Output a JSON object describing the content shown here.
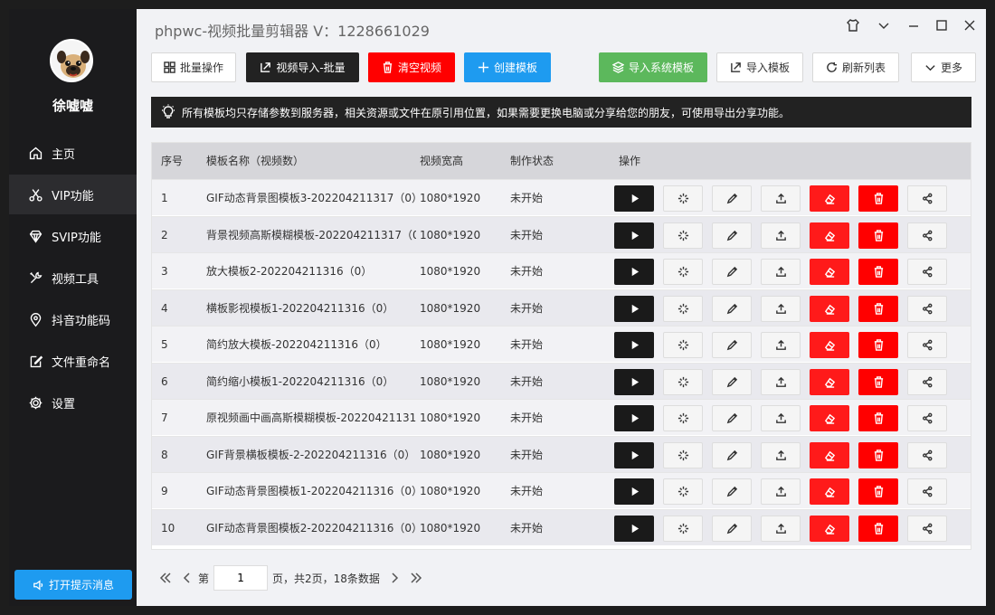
{
  "app": {
    "title": "phpwc-视频批量剪辑器 V：1228661029"
  },
  "sidebar": {
    "username": "徐嘘嘘",
    "items": [
      {
        "label": "主页",
        "icon": "home-icon"
      },
      {
        "label": "VIP功能",
        "icon": "scissors-icon"
      },
      {
        "label": "SVIP功能",
        "icon": "diamond-icon"
      },
      {
        "label": "视频工具",
        "icon": "tools-icon"
      },
      {
        "label": "抖音功能码",
        "icon": "location-icon"
      },
      {
        "label": "文件重命名",
        "icon": "edit-file-icon"
      },
      {
        "label": "设置",
        "icon": "gear-icon"
      }
    ],
    "notify_label": "打开提示消息"
  },
  "toolbar": {
    "batch_ops": "批量操作",
    "import_video_batch": "视频导入-批量",
    "clear_video": "清空视频",
    "create_template": "创建模板",
    "import_system_template": "导入系统模板",
    "import_template": "导入模板",
    "refresh_list": "刷新列表",
    "more": "更多"
  },
  "notice": {
    "text": "所有模板均只存储参数到服务器，相关资源或文件在原引用位置，如果需要更换电脑或分享给您的朋友，可使用导出分享功能。"
  },
  "table": {
    "headers": [
      "序号",
      "模板名称（视频数）",
      "视频宽高",
      "制作状态",
      "操作"
    ],
    "rows": [
      {
        "index": "1",
        "name": "GIF动态背景图模板3-202204211317（0）",
        "size": "1080*1920",
        "status": "未开始"
      },
      {
        "index": "2",
        "name": "背景视频高斯模糊模板-202204211317（0",
        "size": "1080*1920",
        "status": "未开始"
      },
      {
        "index": "3",
        "name": "放大模板2-202204211316（0）",
        "size": "1080*1920",
        "status": "未开始"
      },
      {
        "index": "4",
        "name": "横板影视模板1-202204211316（0）",
        "size": "1080*1920",
        "status": "未开始"
      },
      {
        "index": "5",
        "name": "简约放大模板-202204211316（0）",
        "size": "1080*1920",
        "status": "未开始"
      },
      {
        "index": "6",
        "name": "简约缩小模板1-202204211316（0）",
        "size": "1080*1920",
        "status": "未开始"
      },
      {
        "index": "7",
        "name": "原视频画中画高斯模糊模板-20220421131",
        "size": "1080*1920",
        "status": "未开始"
      },
      {
        "index": "8",
        "name": "GIF背景横板模板-2-202204211316（0）",
        "size": "1080*1920",
        "status": "未开始"
      },
      {
        "index": "9",
        "name": "GIF动态背景图模板1-202204211316（0）",
        "size": "1080*1920",
        "status": "未开始"
      },
      {
        "index": "10",
        "name": "GIF动态背景图模板2-202204211316（0）",
        "size": "1080*1920",
        "status": "未开始"
      }
    ]
  },
  "pager": {
    "prefix": "第",
    "current_page": "1",
    "suffix": "页，共2页，18条数据"
  },
  "colors": {
    "accent_blue": "#1e9bf0",
    "danger_red": "#ff0000",
    "success_green": "#5cb85c",
    "dark": "#222222"
  }
}
